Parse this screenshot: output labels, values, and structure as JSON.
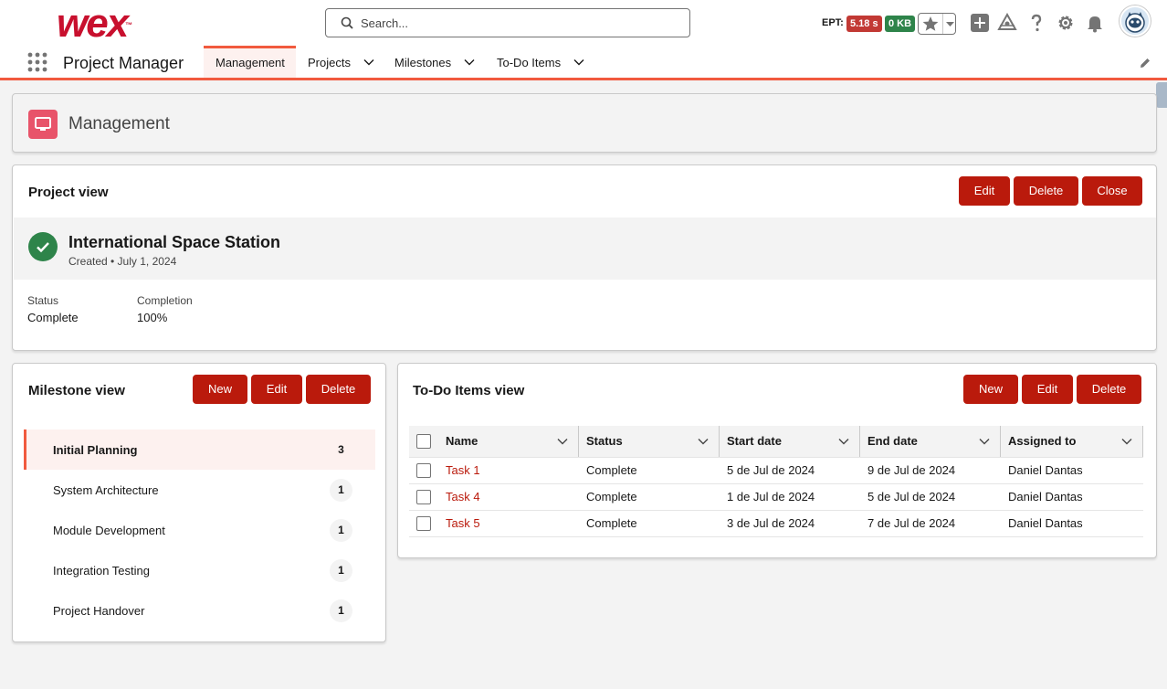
{
  "header": {
    "logo": "wex",
    "logo_tm": "™",
    "search_placeholder": "Search...",
    "ept_label": "EPT:",
    "ept_time": "5.18 s",
    "ept_size": "0 KB",
    "icons": [
      "star-icon",
      "chevron-down-icon",
      "add-icon",
      "trailhead-icon",
      "help-icon",
      "gear-icon",
      "bell-icon",
      "avatar"
    ]
  },
  "nav": {
    "app_name": "Project Manager",
    "tabs": [
      {
        "label": "Management",
        "active": true
      },
      {
        "label": "Projects"
      },
      {
        "label": "Milestones"
      },
      {
        "label": "To-Do Items"
      }
    ]
  },
  "page": {
    "title": "Management",
    "icon": "monitor-icon"
  },
  "project_view": {
    "title": "Project view",
    "buttons": {
      "edit": "Edit",
      "delete": "Delete",
      "close": "Close"
    },
    "project_name": "International Space Station",
    "created": "Created • July 1, 2024",
    "status_label": "Status",
    "status_value": "Complete",
    "completion_label": "Completion",
    "completion_value": "100%"
  },
  "milestone_view": {
    "title": "Milestone view",
    "buttons": {
      "new": "New",
      "edit": "Edit",
      "delete": "Delete"
    },
    "items": [
      {
        "label": "Initial Planning",
        "count": "3",
        "active": true
      },
      {
        "label": "System Architecture",
        "count": "1"
      },
      {
        "label": "Module Development",
        "count": "1"
      },
      {
        "label": "Integration Testing",
        "count": "1"
      },
      {
        "label": "Project Handover",
        "count": "1"
      }
    ]
  },
  "todo_view": {
    "title": "To-Do Items view",
    "buttons": {
      "new": "New",
      "edit": "Edit",
      "delete": "Delete"
    },
    "columns": [
      "Name",
      "Status",
      "Start date",
      "End date",
      "Assigned to"
    ],
    "rows": [
      {
        "name": "Task 1",
        "status": "Complete",
        "start": "5 de Jul de 2024",
        "end": "9 de Jul de 2024",
        "assigned": "Daniel Dantas"
      },
      {
        "name": "Task 4",
        "status": "Complete",
        "start": "1 de Jul de 2024",
        "end": "5 de Jul de 2024",
        "assigned": "Daniel Dantas"
      },
      {
        "name": "Task 5",
        "status": "Complete",
        "start": "3 de Jul de 2024",
        "end": "7 de Jul de 2024",
        "assigned": "Daniel Dantas"
      }
    ]
  },
  "colors": {
    "brand_red": "#c8102e",
    "button_red": "#ba1a0c",
    "accent_orange": "#f15a3e",
    "success_green": "#2e844a",
    "page_icon_pink": "#e8546a"
  }
}
